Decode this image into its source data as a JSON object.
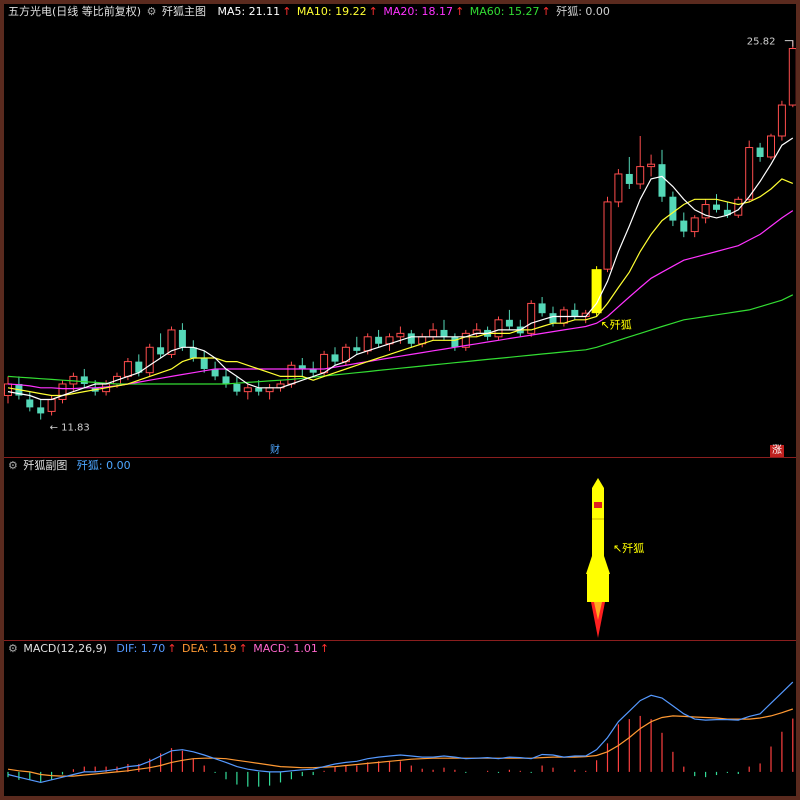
{
  "main_header": {
    "stock": "五方光电(日线 等比前复权)",
    "indicator_name": "歼狐主图",
    "ma5": "MA5: 21.11",
    "ma10": "MA10: 19.22",
    "ma20": "MA20: 18.17",
    "ma60": "MA60: 15.27",
    "signal": "歼狐: 0.00",
    "up_arrow": "↑"
  },
  "sub_header": {
    "name": "歼狐副图",
    "value": "歼狐: 0.00"
  },
  "macd_header": {
    "name": "MACD(12,26,9)",
    "dif": "DIF: 1.70",
    "dea": "DEA: 1.19",
    "macd": "MACD: 1.01",
    "up_arrow": "↑"
  },
  "markers": {
    "cai": "财",
    "zhang": "涨",
    "jianhu_main": "歼狐",
    "jianhu_sub": "歼狐",
    "arrow": "↖"
  },
  "colors": {
    "up": "#ff4d4d",
    "down": "#55d8b8",
    "ma5": "#ffffff",
    "ma10": "#ffff33",
    "ma20": "#ff33ff",
    "ma60": "#33dd33",
    "dif": "#5599ff",
    "dea": "#ff9933",
    "signal": "#ffff00"
  },
  "chart_data": {
    "type": "candlestick",
    "title": "五方光电(日线 等比前复权)",
    "price_labels": {
      "high": "← 11.83",
      "max": "25.82"
    },
    "price_range": [
      11.5,
      26.5
    ],
    "candles_ohlc": [
      [
        12.4,
        12.9,
        12.2,
        12.7
      ],
      [
        12.7,
        12.9,
        12.3,
        12.4
      ],
      [
        12.3,
        12.5,
        12.0,
        12.1
      ],
      [
        12.1,
        12.3,
        11.8,
        11.95
      ],
      [
        12.0,
        12.4,
        11.9,
        12.3
      ],
      [
        12.3,
        12.8,
        12.2,
        12.7
      ],
      [
        12.7,
        13.0,
        12.5,
        12.9
      ],
      [
        12.9,
        13.1,
        12.6,
        12.7
      ],
      [
        12.6,
        12.8,
        12.4,
        12.5
      ],
      [
        12.5,
        12.8,
        12.4,
        12.7
      ],
      [
        12.7,
        13.0,
        12.6,
        12.9
      ],
      [
        12.9,
        13.4,
        12.8,
        13.3
      ],
      [
        13.3,
        13.5,
        12.9,
        13.0
      ],
      [
        13.0,
        13.8,
        12.9,
        13.7
      ],
      [
        13.7,
        14.1,
        13.4,
        13.5
      ],
      [
        13.5,
        14.3,
        13.4,
        14.2
      ],
      [
        14.2,
        14.4,
        13.6,
        13.7
      ],
      [
        13.7,
        13.9,
        13.3,
        13.4
      ],
      [
        13.4,
        13.6,
        13.0,
        13.1
      ],
      [
        13.1,
        13.3,
        12.8,
        12.9
      ],
      [
        12.9,
        13.1,
        12.6,
        12.7
      ],
      [
        12.7,
        12.9,
        12.4,
        12.5
      ],
      [
        12.5,
        12.7,
        12.3,
        12.6
      ],
      [
        12.6,
        12.8,
        12.4,
        12.5
      ],
      [
        12.5,
        12.7,
        12.3,
        12.6
      ],
      [
        12.6,
        12.8,
        12.5,
        12.7
      ],
      [
        12.7,
        13.3,
        12.6,
        13.2
      ],
      [
        13.2,
        13.4,
        12.9,
        13.1
      ],
      [
        13.1,
        13.3,
        12.9,
        13.0
      ],
      [
        13.0,
        13.6,
        12.9,
        13.5
      ],
      [
        13.5,
        13.7,
        13.2,
        13.3
      ],
      [
        13.3,
        13.8,
        13.2,
        13.7
      ],
      [
        13.7,
        14.0,
        13.5,
        13.6
      ],
      [
        13.6,
        14.1,
        13.5,
        14.0
      ],
      [
        14.0,
        14.2,
        13.7,
        13.8
      ],
      [
        13.8,
        14.1,
        13.6,
        14.0
      ],
      [
        14.0,
        14.3,
        13.8,
        14.1
      ],
      [
        14.1,
        14.2,
        13.7,
        13.8
      ],
      [
        13.8,
        14.1,
        13.7,
        14.0
      ],
      [
        14.0,
        14.4,
        13.9,
        14.2
      ],
      [
        14.2,
        14.5,
        13.9,
        14.0
      ],
      [
        14.0,
        14.1,
        13.6,
        13.7
      ],
      [
        13.7,
        14.2,
        13.6,
        14.1
      ],
      [
        14.1,
        14.4,
        14.0,
        14.2
      ],
      [
        14.2,
        14.3,
        13.9,
        14.0
      ],
      [
        14.0,
        14.6,
        13.9,
        14.5
      ],
      [
        14.5,
        14.8,
        14.2,
        14.3
      ],
      [
        14.3,
        14.5,
        14.0,
        14.1
      ],
      [
        14.1,
        15.1,
        14.0,
        15.0
      ],
      [
        15.0,
        15.2,
        14.6,
        14.7
      ],
      [
        14.7,
        14.9,
        14.3,
        14.4
      ],
      [
        14.4,
        14.9,
        14.3,
        14.8
      ],
      [
        14.8,
        15.0,
        14.5,
        14.6
      ],
      [
        14.6,
        14.8,
        14.4,
        14.7
      ],
      [
        14.7,
        16.2,
        14.6,
        16.1
      ],
      [
        16.1,
        18.7,
        16.0,
        18.5
      ],
      [
        18.5,
        19.8,
        18.3,
        19.6
      ],
      [
        19.6,
        20.3,
        19.0,
        19.2
      ],
      [
        19.2,
        21.2,
        19.0,
        19.9
      ],
      [
        19.9,
        20.4,
        19.5,
        20.0
      ],
      [
        20.0,
        20.6,
        18.5,
        18.7
      ],
      [
        18.7,
        18.9,
        17.6,
        17.8
      ],
      [
        17.8,
        18.1,
        17.2,
        17.4
      ],
      [
        17.4,
        18.0,
        17.2,
        17.9
      ],
      [
        17.9,
        18.6,
        17.7,
        18.4
      ],
      [
        18.4,
        18.8,
        18.1,
        18.2
      ],
      [
        18.2,
        18.5,
        17.9,
        18.0
      ],
      [
        18.0,
        18.7,
        17.9,
        18.6
      ],
      [
        18.6,
        21.0,
        18.5,
        20.7
      ],
      [
        20.7,
        20.9,
        20.1,
        20.3
      ],
      [
        20.3,
        21.3,
        20.2,
        21.2
      ],
      [
        21.2,
        22.8,
        21.0,
        22.6
      ],
      [
        22.6,
        25.82,
        22.5,
        25.4
      ]
    ],
    "ma5": [
      12.5,
      12.45,
      12.4,
      12.3,
      12.3,
      12.4,
      12.5,
      12.6,
      12.7,
      12.7,
      12.8,
      12.9,
      13.0,
      13.2,
      13.4,
      13.6,
      13.7,
      13.7,
      13.6,
      13.4,
      13.1,
      12.9,
      12.7,
      12.6,
      12.6,
      12.6,
      12.7,
      12.8,
      12.9,
      13.0,
      13.2,
      13.3,
      13.5,
      13.6,
      13.7,
      13.8,
      13.9,
      14.0,
      14.0,
      14.0,
      14.0,
      14.0,
      14.0,
      14.1,
      14.1,
      14.2,
      14.2,
      14.2,
      14.4,
      14.5,
      14.6,
      14.6,
      14.6,
      14.6,
      15.0,
      15.7,
      16.7,
      17.6,
      18.6,
      19.4,
      19.5,
      19.1,
      18.6,
      18.2,
      18.0,
      17.9,
      18.0,
      18.2,
      18.7,
      19.3,
      20.0,
      20.8,
      21.11
    ],
    "ma10": [
      12.6,
      12.55,
      12.5,
      12.45,
      12.4,
      12.4,
      12.45,
      12.5,
      12.55,
      12.6,
      12.65,
      12.7,
      12.8,
      12.9,
      13.0,
      13.1,
      13.3,
      13.4,
      13.4,
      13.4,
      13.3,
      13.3,
      13.2,
      13.1,
      13.0,
      12.9,
      12.9,
      12.9,
      12.8,
      12.9,
      13.0,
      13.1,
      13.2,
      13.3,
      13.4,
      13.5,
      13.6,
      13.7,
      13.8,
      13.9,
      13.9,
      13.9,
      14.0,
      14.0,
      14.1,
      14.1,
      14.1,
      14.2,
      14.2,
      14.3,
      14.4,
      14.4,
      14.5,
      14.5,
      14.6,
      15.0,
      15.5,
      16.0,
      16.7,
      17.3,
      17.8,
      18.1,
      18.4,
      18.6,
      18.6,
      18.6,
      18.5,
      18.4,
      18.5,
      18.7,
      19.0,
      19.4,
      19.22
    ],
    "ma20": [
      12.7,
      12.68,
      12.65,
      12.6,
      12.6,
      12.58,
      12.58,
      12.6,
      12.6,
      12.62,
      12.65,
      12.7,
      12.75,
      12.8,
      12.85,
      12.9,
      12.95,
      13.0,
      13.05,
      13.1,
      13.1,
      13.1,
      13.1,
      13.1,
      13.1,
      13.1,
      13.1,
      13.1,
      13.1,
      13.1,
      13.15,
      13.2,
      13.25,
      13.3,
      13.35,
      13.4,
      13.45,
      13.5,
      13.55,
      13.6,
      13.65,
      13.7,
      13.75,
      13.8,
      13.85,
      13.9,
      13.95,
      14.0,
      14.05,
      14.1,
      14.15,
      14.2,
      14.25,
      14.3,
      14.4,
      14.6,
      14.9,
      15.2,
      15.5,
      15.8,
      16.0,
      16.2,
      16.4,
      16.5,
      16.6,
      16.7,
      16.8,
      16.9,
      17.1,
      17.3,
      17.6,
      17.9,
      18.17
    ],
    "ma60": [
      12.9,
      12.88,
      12.86,
      12.84,
      12.82,
      12.8,
      12.78,
      12.76,
      12.74,
      12.72,
      12.7,
      12.7,
      12.7,
      12.7,
      12.7,
      12.7,
      12.7,
      12.7,
      12.7,
      12.7,
      12.7,
      12.72,
      12.74,
      12.76,
      12.78,
      12.8,
      12.82,
      12.85,
      12.88,
      12.91,
      12.94,
      12.97,
      13.0,
      13.03,
      13.06,
      13.09,
      13.12,
      13.15,
      13.18,
      13.21,
      13.24,
      13.27,
      13.3,
      13.33,
      13.36,
      13.39,
      13.42,
      13.45,
      13.48,
      13.51,
      13.54,
      13.57,
      13.6,
      13.63,
      13.7,
      13.8,
      13.9,
      14.0,
      14.1,
      14.2,
      14.3,
      14.4,
      14.5,
      14.55,
      14.6,
      14.65,
      14.7,
      14.75,
      14.8,
      14.9,
      15.0,
      15.1,
      15.27
    ],
    "signal_index": 54,
    "macd": {
      "range": [
        -0.4,
        2.1
      ],
      "dif": [
        -0.05,
        -0.1,
        -0.15,
        -0.2,
        -0.15,
        -0.1,
        -0.05,
        0.0,
        0.0,
        0.02,
        0.05,
        0.1,
        0.12,
        0.2,
        0.3,
        0.4,
        0.42,
        0.38,
        0.32,
        0.25,
        0.18,
        0.1,
        0.05,
        0.02,
        0.0,
        0.0,
        0.02,
        0.04,
        0.05,
        0.1,
        0.15,
        0.18,
        0.2,
        0.25,
        0.28,
        0.3,
        0.32,
        0.3,
        0.28,
        0.28,
        0.3,
        0.28,
        0.25,
        0.26,
        0.27,
        0.25,
        0.28,
        0.27,
        0.25,
        0.33,
        0.32,
        0.28,
        0.3,
        0.3,
        0.42,
        0.65,
        0.95,
        1.15,
        1.35,
        1.45,
        1.4,
        1.25,
        1.1,
        1.0,
        0.98,
        0.99,
        0.99,
        0.98,
        1.05,
        1.1,
        1.3,
        1.5,
        1.7
      ],
      "dea": [
        0.05,
        0.02,
        0.0,
        -0.05,
        -0.07,
        -0.08,
        -0.08,
        -0.06,
        -0.04,
        -0.02,
        0.0,
        0.02,
        0.05,
        0.08,
        0.12,
        0.18,
        0.22,
        0.25,
        0.26,
        0.26,
        0.25,
        0.22,
        0.19,
        0.16,
        0.13,
        0.1,
        0.09,
        0.08,
        0.08,
        0.09,
        0.1,
        0.12,
        0.14,
        0.16,
        0.18,
        0.2,
        0.22,
        0.24,
        0.25,
        0.26,
        0.26,
        0.26,
        0.26,
        0.26,
        0.26,
        0.26,
        0.26,
        0.26,
        0.26,
        0.27,
        0.28,
        0.28,
        0.28,
        0.29,
        0.31,
        0.38,
        0.5,
        0.65,
        0.82,
        0.95,
        1.03,
        1.06,
        1.05,
        1.04,
        1.03,
        1.02,
        1.0,
        1.0,
        1.0,
        1.02,
        1.06,
        1.12,
        1.19
      ],
      "hist": [
        -0.1,
        -0.15,
        -0.15,
        -0.2,
        -0.15,
        -0.05,
        0.05,
        0.1,
        0.1,
        0.1,
        0.1,
        0.15,
        0.15,
        0.25,
        0.35,
        0.45,
        0.4,
        0.25,
        0.12,
        -0.02,
        -0.14,
        -0.24,
        -0.28,
        -0.28,
        -0.26,
        -0.2,
        -0.14,
        -0.08,
        -0.06,
        0.02,
        0.1,
        0.12,
        0.12,
        0.18,
        0.2,
        0.2,
        0.2,
        0.12,
        0.06,
        0.04,
        0.08,
        0.04,
        -0.02,
        0.0,
        0.02,
        -0.02,
        0.04,
        0.02,
        -0.02,
        0.12,
        0.08,
        0.0,
        0.04,
        0.02,
        0.22,
        0.54,
        0.9,
        1.0,
        1.06,
        1.0,
        0.74,
        0.38,
        0.1,
        -0.08,
        -0.1,
        -0.06,
        -0.02,
        -0.04,
        0.1,
        0.16,
        0.48,
        0.76,
        1.01
      ]
    }
  }
}
